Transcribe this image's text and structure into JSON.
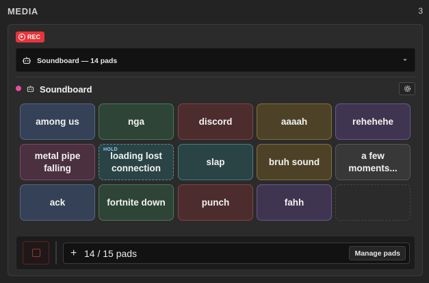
{
  "header": {
    "title": "MEDIA",
    "count": "3"
  },
  "rec": {
    "label": "REC",
    "color": "#e5353a"
  },
  "selector": {
    "value": "Soundboard — 14 pads"
  },
  "soundboard": {
    "title": "Soundboard",
    "dot_color": "#e84e9d"
  },
  "pads": [
    {
      "label": "among us",
      "color": "blue"
    },
    {
      "label": "nga",
      "color": "green"
    },
    {
      "label": "discord",
      "color": "red"
    },
    {
      "label": "aaaah",
      "color": "gold"
    },
    {
      "label": "rehehehe",
      "color": "purple"
    },
    {
      "label": "metal pipe falling",
      "color": "mauve"
    },
    {
      "label": "loading lost connection",
      "color": "teal",
      "badge": "HOLD"
    },
    {
      "label": "slap",
      "color": "teal"
    },
    {
      "label": "bruh sound",
      "color": "gold"
    },
    {
      "label": "a few moments...",
      "color": "gray"
    },
    {
      "label": "ack",
      "color": "blue"
    },
    {
      "label": "fortnite down",
      "color": "green"
    },
    {
      "label": "punch",
      "color": "red"
    },
    {
      "label": "fahh",
      "color": "purple"
    }
  ],
  "footer": {
    "plus": "+",
    "pad_count": "14 / 15 pads",
    "manage_label": "Manage pads"
  },
  "icons": {
    "rec": "record-icon",
    "selector": "robot-icon",
    "chevron": "chevron-down-icon",
    "settings": "gear-icon",
    "stop": "stop-icon"
  }
}
